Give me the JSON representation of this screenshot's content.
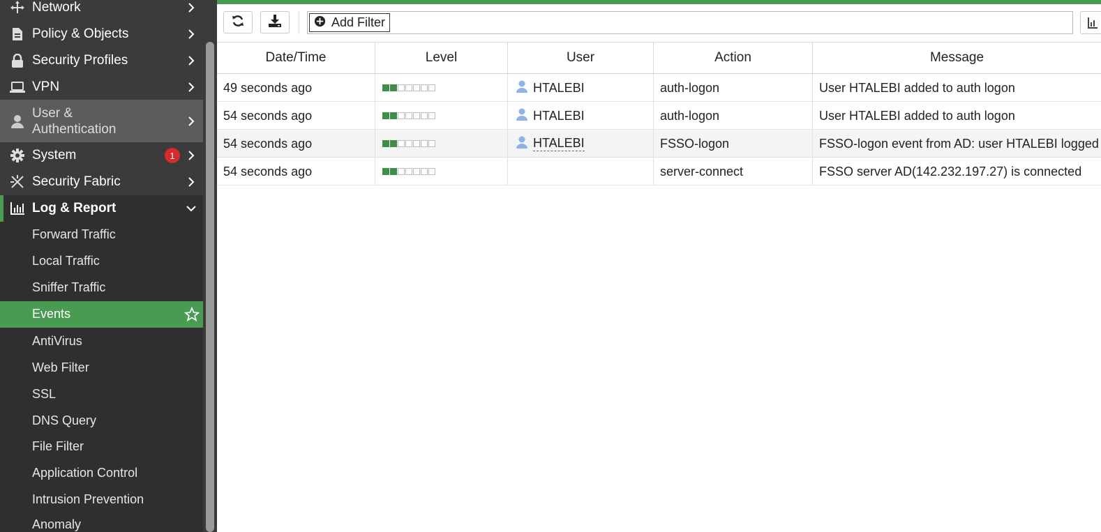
{
  "sidebar": {
    "items": [
      {
        "label": "Network",
        "icon": "network-icon"
      },
      {
        "label": "Policy & Objects",
        "icon": "policy-icon"
      },
      {
        "label": "Security Profiles",
        "icon": "lock-icon"
      },
      {
        "label": "VPN",
        "icon": "laptop-icon"
      },
      {
        "label": "User &",
        "label2": "Authentication",
        "icon": "user-icon"
      },
      {
        "label": "System",
        "icon": "gear-icon",
        "badge": "1"
      },
      {
        "label": "Security Fabric",
        "icon": "fabric-icon"
      },
      {
        "label": "Log & Report",
        "icon": "chart-icon"
      }
    ],
    "sub_items": [
      "Forward Traffic",
      "Local Traffic",
      "Sniffer Traffic",
      "Events",
      "AntiVirus",
      "Web Filter",
      "SSL",
      "DNS Query",
      "File Filter",
      "Application Control",
      "Intrusion Prevention",
      "Anomaly"
    ],
    "selected_sub": "Events"
  },
  "toolbar": {
    "refresh_icon": "refresh-icon",
    "download_icon": "download-icon",
    "add_filter_label": "Add Filter"
  },
  "table": {
    "columns": [
      "Date/Time",
      "Level",
      "User",
      "Action",
      "Message"
    ],
    "rows": [
      {
        "time": "49 seconds ago",
        "level": 2,
        "user": "HTALEBI",
        "action": "auth-logon",
        "message": "User HTALEBI added to auth logon"
      },
      {
        "time": "54 seconds ago",
        "level": 2,
        "user": "HTALEBI",
        "action": "auth-logon",
        "message": "User HTALEBI added to auth logon"
      },
      {
        "time": "54 seconds ago",
        "level": 2,
        "user": "HTALEBI",
        "action": "FSSO-logon",
        "message": "FSSO-logon event from AD: user HTALEBI logged"
      },
      {
        "time": "54 seconds ago",
        "level": 2,
        "user": "",
        "action": "server-connect",
        "message": "FSSO server AD(142.232.197.27) is connected"
      }
    ]
  },
  "colors": {
    "accent": "#4a9b52",
    "sidebar_bg": "#3b3b3b",
    "badge": "#d62b2b",
    "user_icon": "#8fb3e8"
  }
}
